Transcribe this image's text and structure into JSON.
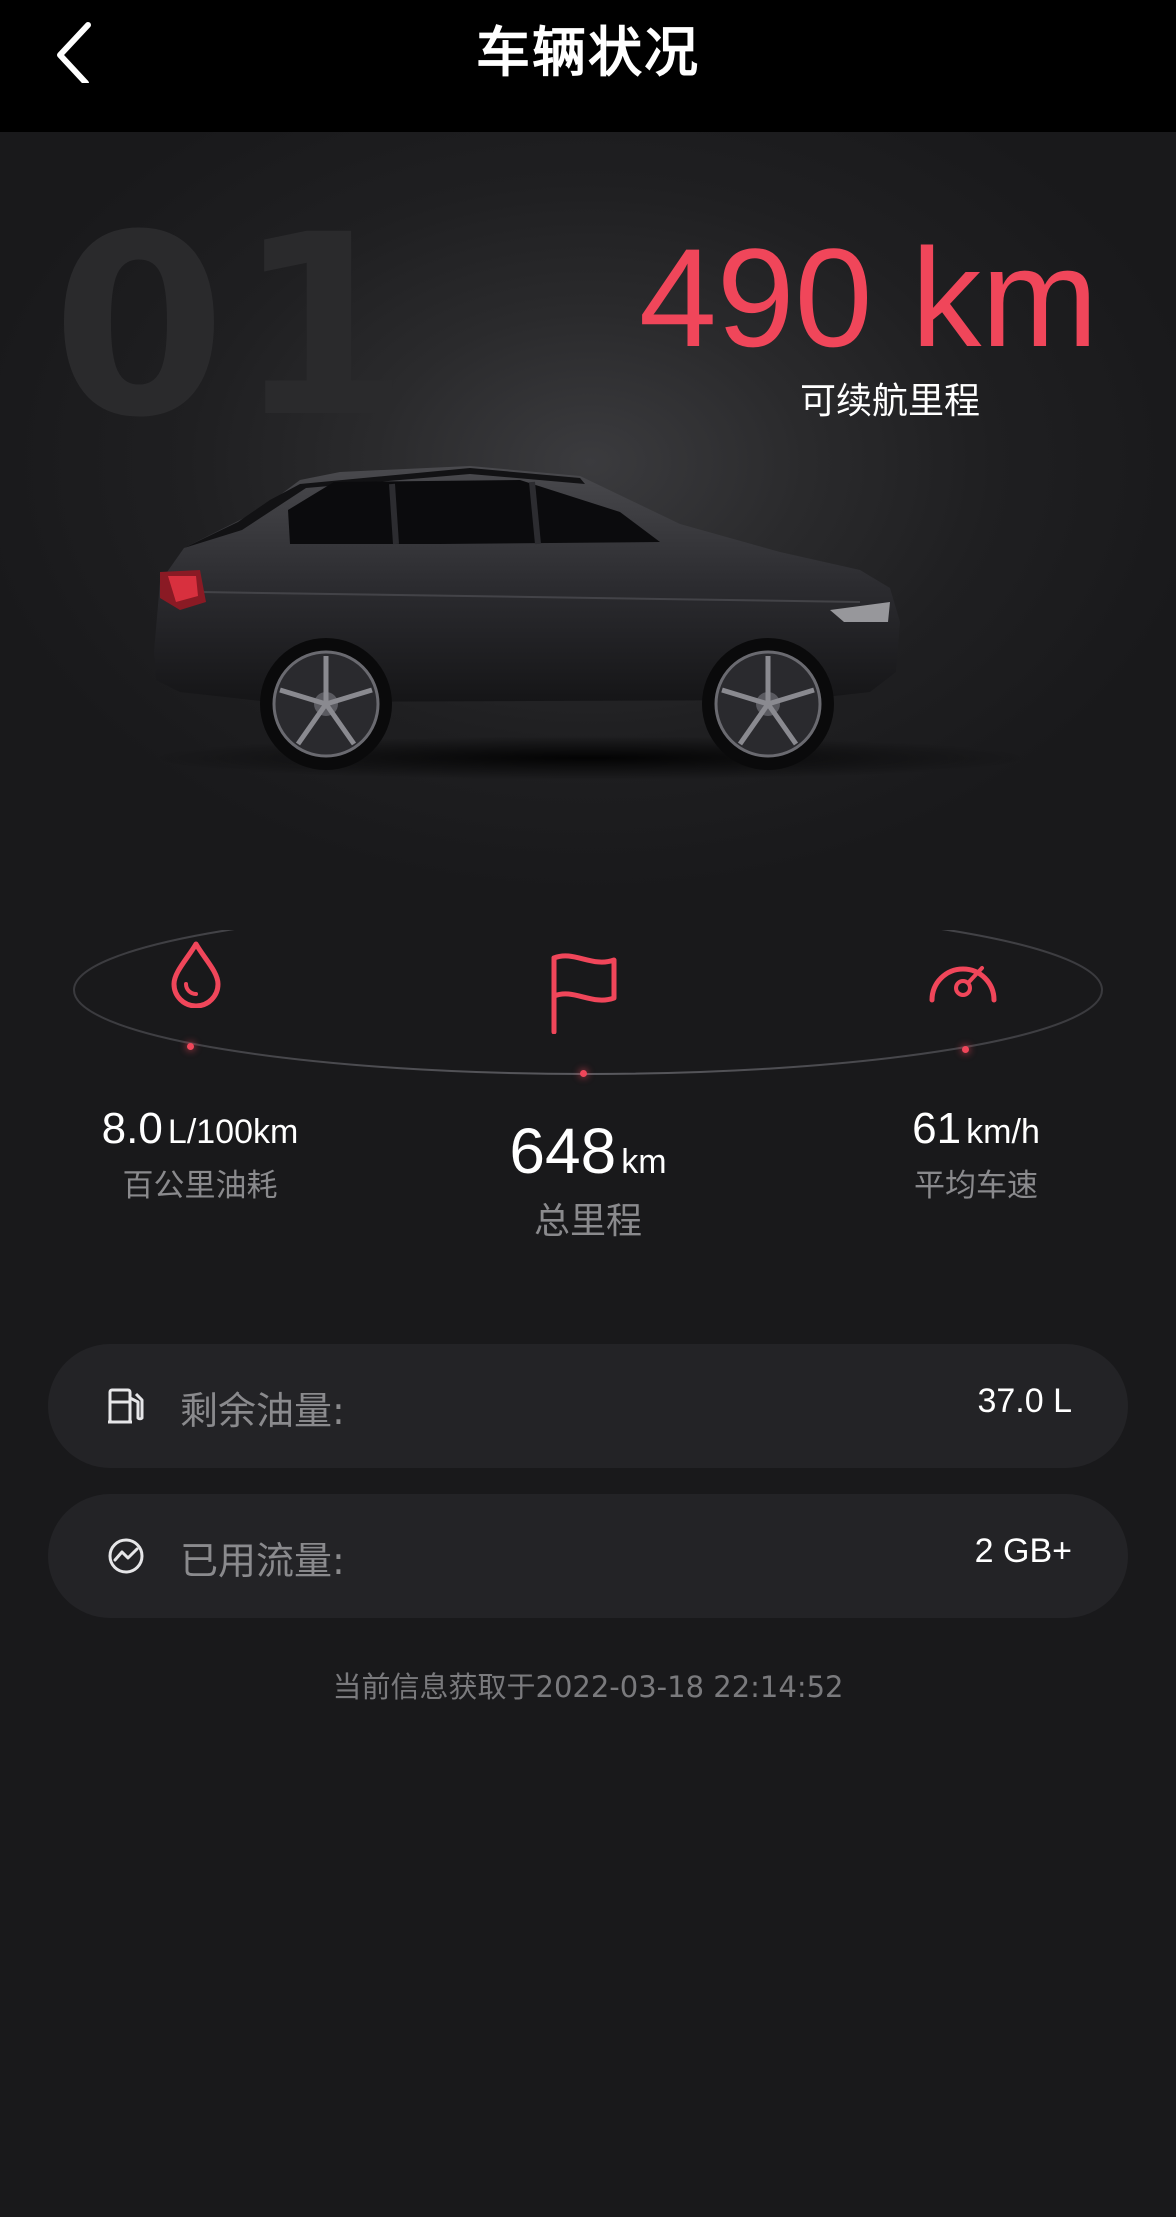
{
  "header": {
    "title": "车辆状况"
  },
  "hero": {
    "watermark": "01",
    "range_value": "490 km",
    "range_label": "可续航里程"
  },
  "stats": {
    "fuel_consumption": {
      "value": "8.0",
      "unit": "L/100km",
      "label": "百公里油耗",
      "icon": "droplet-icon"
    },
    "total_mileage": {
      "value": "648",
      "unit": "km",
      "label": "总里程",
      "icon": "flag-icon"
    },
    "avg_speed": {
      "value": "61",
      "unit": "km/h",
      "label": "平均车速",
      "icon": "speedometer-icon"
    }
  },
  "cards": {
    "fuel": {
      "label": "剩余油量:",
      "value": "37.0 L",
      "icon": "fuel-pump-icon"
    },
    "data": {
      "label": "已用流量:",
      "value": "2 GB+",
      "icon": "traffic-chart-icon"
    }
  },
  "footer": {
    "timestamp": "当前信息获取于2022-03-18 22:14:52"
  },
  "colors": {
    "accent": "#f0465a",
    "background": "#19191b",
    "card": "#232326"
  }
}
